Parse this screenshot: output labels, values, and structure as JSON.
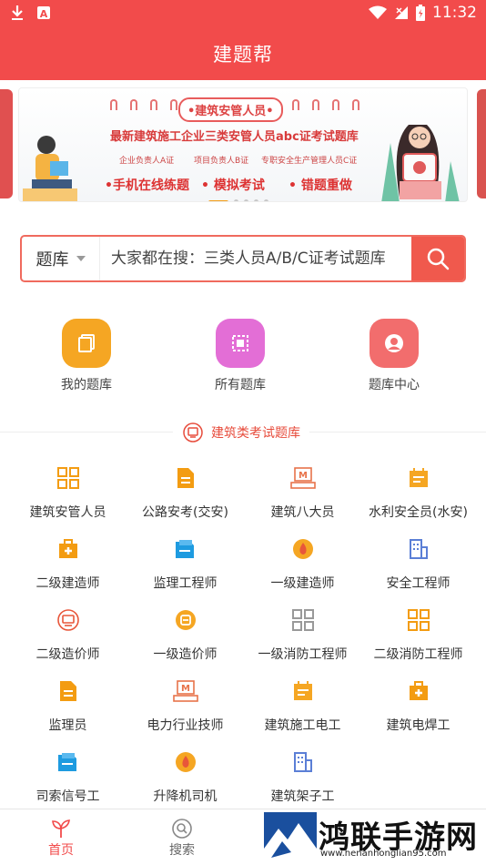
{
  "status_bar": {
    "time": "11:32"
  },
  "app": {
    "title": "建题帮"
  },
  "banner": {
    "tag": "•建筑安管人员•",
    "headline": "最新建筑施工企业三类安管人员abc证考试题库",
    "subs": [
      "企业负责人A证",
      "项目负责人B证",
      "专职安全生产管理人员C证"
    ],
    "features": [
      "•手机在线练题",
      "• 模拟考试",
      "• 错题重做"
    ]
  },
  "search": {
    "type_label": "题库",
    "placeholder": "大家都在搜：三类人员A/B/C证考试题库"
  },
  "quick_entries": [
    {
      "label": "我的题库",
      "color": "#f5a623",
      "icon": "copy-icon"
    },
    {
      "label": "所有题库",
      "color": "#e36ed6",
      "icon": "square-icon"
    },
    {
      "label": "题库中心",
      "color": "#f26d6d",
      "icon": "user-circle-icon"
    }
  ],
  "section": {
    "title": "建筑类考试题库"
  },
  "categories": [
    {
      "label": "建筑安管人员",
      "icon": "grid-icon"
    },
    {
      "label": "公路安考(交安)",
      "icon": "document-icon"
    },
    {
      "label": "建筑八大员",
      "icon": "cert-icon"
    },
    {
      "label": "水利安全员(水安)",
      "icon": "calendar-icon"
    },
    {
      "label": "二级建造师",
      "icon": "medkit-icon"
    },
    {
      "label": "监理工程师",
      "icon": "folder-icon"
    },
    {
      "label": "一级建造师",
      "icon": "fire-icon"
    },
    {
      "label": "安全工程师",
      "icon": "building-icon"
    },
    {
      "label": "二级造价师",
      "icon": "monitor-icon"
    },
    {
      "label": "一级造价师",
      "icon": "coin-icon"
    },
    {
      "label": "一级消防工程师",
      "icon": "grid-gray-icon"
    },
    {
      "label": "二级消防工程师",
      "icon": "grid-icon"
    },
    {
      "label": "监理员",
      "icon": "document-icon"
    },
    {
      "label": "电力行业技师",
      "icon": "cert-icon"
    },
    {
      "label": "建筑施工电工",
      "icon": "calendar-icon"
    },
    {
      "label": "建筑电焊工",
      "icon": "medkit-icon"
    },
    {
      "label": "司索信号工",
      "icon": "folder-icon"
    },
    {
      "label": "升降机司机",
      "icon": "fire-icon"
    },
    {
      "label": "建筑架子工",
      "icon": "building-icon"
    }
  ],
  "bottom_nav": [
    {
      "label": "首页",
      "active": true
    },
    {
      "label": "搜索",
      "active": false
    }
  ],
  "watermark": {
    "name": "鸿联手游网",
    "url": "www.henanhonglian95.com"
  },
  "colors": {
    "brand": "#f24b4b",
    "accent_orange": "#f39c12",
    "section_red": "#e74c3c"
  }
}
